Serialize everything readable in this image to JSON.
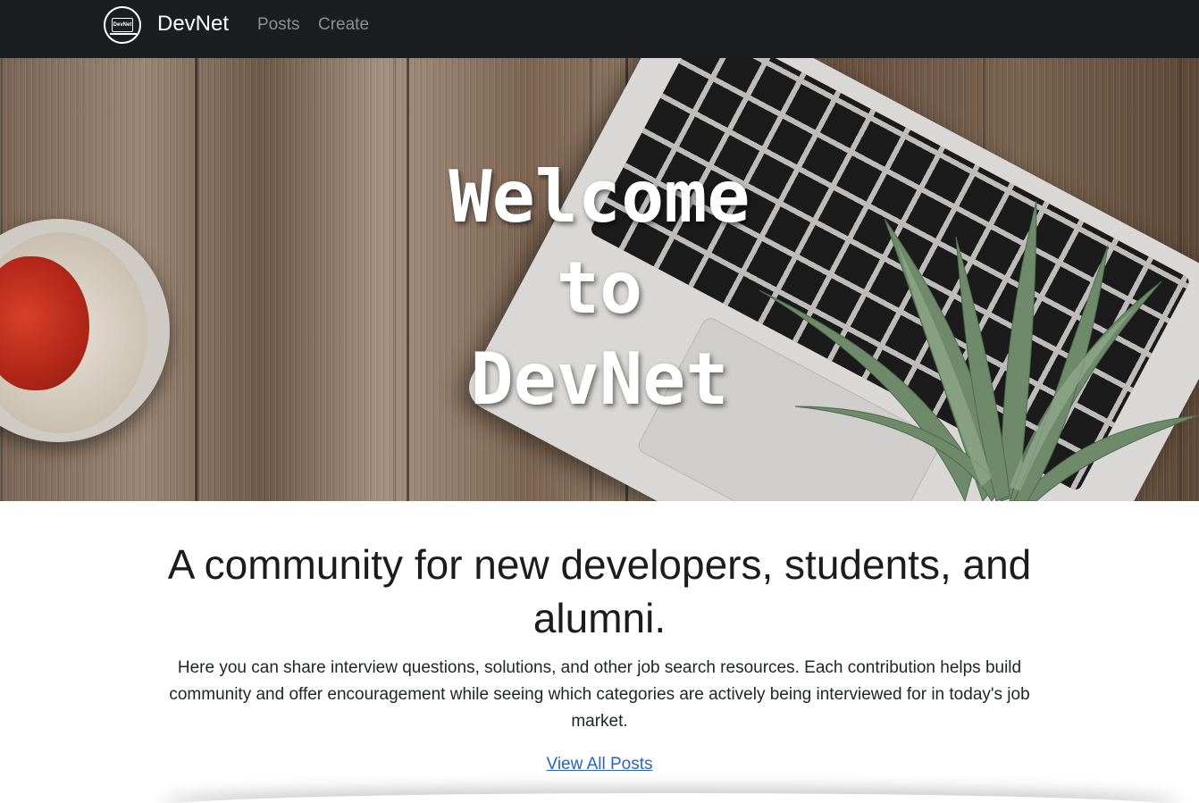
{
  "navbar": {
    "logo_text": "DevNet",
    "brand": "DevNet",
    "links": [
      {
        "label": "Posts"
      },
      {
        "label": "Create"
      }
    ]
  },
  "hero": {
    "title": "Welcome\nto\nDevNet"
  },
  "main": {
    "headline": "A community for new developers, students, and alumni.",
    "description": "Here you can share interview questions, solutions, and other job search resources. Each contribution helps build community and offer encouragement while seeing which categories are actively being interviewed for in today's job market.",
    "cta_label": "View All Posts"
  },
  "colors": {
    "navbar_bg": "#1c1d20",
    "nav_link": "#8c8e92",
    "link_blue": "#2a63c9"
  }
}
